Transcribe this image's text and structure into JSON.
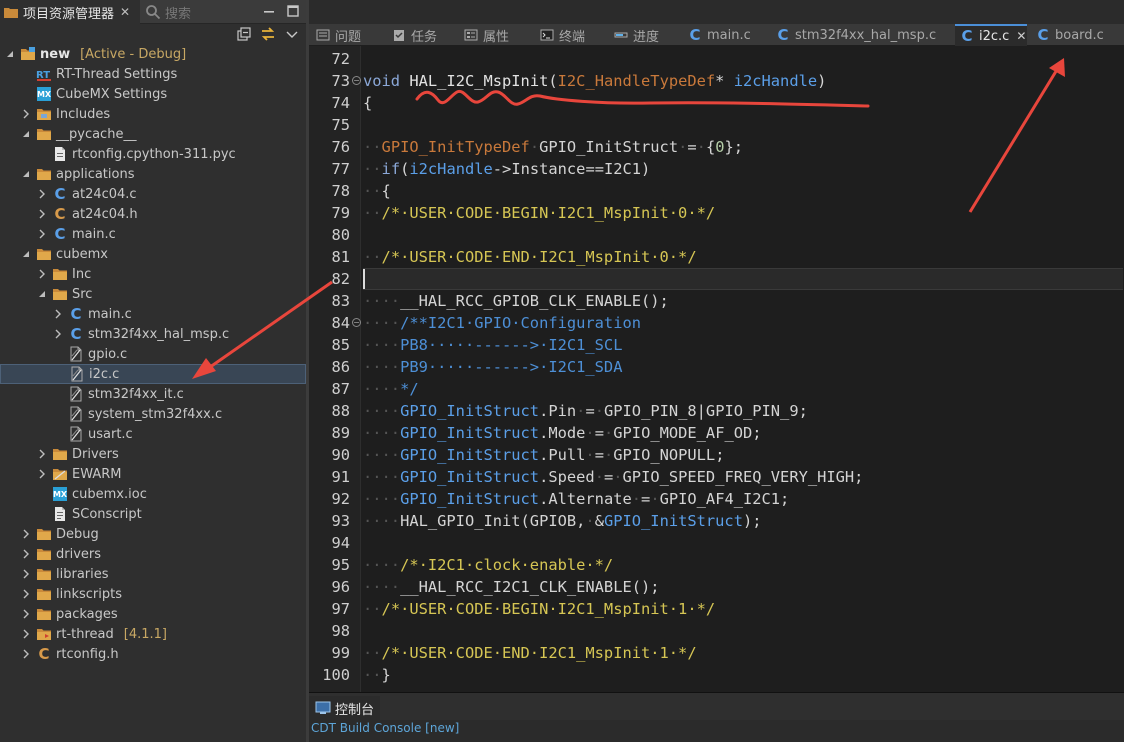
{
  "left_panel": {
    "explorer_tab": "项目资源管理器",
    "search_placeholder": "搜索"
  },
  "tree": [
    {
      "level": 0,
      "expanded": true,
      "icon": "project-folder-icon",
      "label": "new",
      "suffix": "[Active - Debug]",
      "bold": true
    },
    {
      "level": 1,
      "icon": "rt-thread-settings-icon",
      "label": "RT-Thread Settings"
    },
    {
      "level": 1,
      "icon": "cubemx-icon",
      "label": "CubeMX Settings"
    },
    {
      "level": 1,
      "expanded": false,
      "icon": "includes-folder-icon",
      "label": "Includes"
    },
    {
      "level": 1,
      "expanded": true,
      "icon": "folder-icon",
      "label": "__pycache__"
    },
    {
      "level": 2,
      "icon": "pyc-file-icon",
      "label": "rtconfig.cpython-311.pyc"
    },
    {
      "level": 1,
      "expanded": true,
      "icon": "folder-icon",
      "label": "applications"
    },
    {
      "level": 2,
      "expanded": false,
      "icon": "c-file-icon",
      "label": "at24c04.c"
    },
    {
      "level": 2,
      "expanded": false,
      "icon": "h-file-icon",
      "label": "at24c04.h"
    },
    {
      "level": 2,
      "expanded": false,
      "icon": "c-file-icon",
      "label": "main.c"
    },
    {
      "level": 1,
      "expanded": true,
      "icon": "folder-icon",
      "label": "cubemx"
    },
    {
      "level": 2,
      "expanded": false,
      "icon": "folder-icon",
      "label": "Inc"
    },
    {
      "level": 2,
      "expanded": true,
      "icon": "folder-icon",
      "label": "Src"
    },
    {
      "level": 3,
      "expanded": false,
      "icon": "c-file-icon",
      "label": "main.c"
    },
    {
      "level": 3,
      "expanded": false,
      "icon": "c-file-icon",
      "label": "stm32f4xx_hal_msp.c"
    },
    {
      "level": 3,
      "icon": "excluded-file-icon",
      "label": "gpio.c"
    },
    {
      "level": 3,
      "icon": "excluded-file-icon",
      "label": "i2c.c",
      "selected": true
    },
    {
      "level": 3,
      "icon": "excluded-file-icon",
      "label": "stm32f4xx_it.c"
    },
    {
      "level": 3,
      "icon": "excluded-file-icon",
      "label": "system_stm32f4xx.c"
    },
    {
      "level": 3,
      "icon": "excluded-file-icon",
      "label": "usart.c"
    },
    {
      "level": 2,
      "expanded": false,
      "icon": "folder-icon",
      "label": "Drivers"
    },
    {
      "level": 2,
      "expanded": false,
      "icon": "excluded-folder-icon",
      "label": "EWARM"
    },
    {
      "level": 2,
      "icon": "cubemx-icon",
      "label": "cubemx.ioc"
    },
    {
      "level": 2,
      "icon": "sconscript-file-icon",
      "label": "SConscript"
    },
    {
      "level": 1,
      "expanded": false,
      "icon": "folder-icon",
      "label": "Debug"
    },
    {
      "level": 1,
      "expanded": false,
      "icon": "folder-icon",
      "label": "drivers"
    },
    {
      "level": 1,
      "expanded": false,
      "icon": "folder-icon",
      "label": "libraries"
    },
    {
      "level": 1,
      "expanded": false,
      "icon": "folder-icon",
      "label": "linkscripts"
    },
    {
      "level": 1,
      "expanded": false,
      "icon": "folder-icon",
      "label": "packages"
    },
    {
      "level": 1,
      "expanded": false,
      "icon": "rt-thread-folder-icon",
      "label": "rt-thread",
      "suffix": "[4.1.1]"
    },
    {
      "level": 1,
      "expanded": false,
      "icon": "h-file-icon",
      "label": "rtconfig.h"
    }
  ],
  "editor_tabs": [
    {
      "label": "问题",
      "icon": "problems-icon"
    },
    {
      "label": "任务",
      "icon": "tasks-icon"
    },
    {
      "label": "属性",
      "icon": "properties-icon"
    },
    {
      "label": "终端",
      "icon": "terminal-icon"
    },
    {
      "label": "进度",
      "icon": "progress-icon"
    },
    {
      "label": "main.c",
      "icon": "c-file-icon"
    },
    {
      "label": "stm32f4xx_hal_msp.c",
      "icon": "c-file-icon"
    },
    {
      "label": "i2c.c",
      "icon": "c-file-icon",
      "active": true
    },
    {
      "label": "board.c",
      "icon": "c-file-icon"
    }
  ],
  "code_lines": [
    {
      "n": "72",
      "t": []
    },
    {
      "n": "73",
      "fold": true,
      "t": [
        [
          "kw",
          "void"
        ],
        [
          "op",
          " "
        ],
        [
          "fn",
          "HAL_I2C_MspInit"
        ],
        [
          "op",
          "("
        ],
        [
          "ty",
          "I2C_HandleTypeDef"
        ],
        [
          "op",
          "* "
        ],
        [
          "param",
          "i2cHandle"
        ],
        [
          "op",
          ")"
        ]
      ]
    },
    {
      "n": "74",
      "t": [
        [
          "op",
          "{"
        ]
      ]
    },
    {
      "n": "75",
      "t": []
    },
    {
      "n": "76",
      "t": [
        [
          "ws",
          "··"
        ],
        [
          "ty",
          "GPIO_InitTypeDef"
        ],
        [
          "ws",
          "·"
        ],
        [
          "op",
          "GPIO_InitStruct"
        ],
        [
          "ws",
          "·"
        ],
        [
          "op",
          "="
        ],
        [
          "ws",
          "·"
        ],
        [
          "op",
          "{"
        ],
        [
          "num",
          "0"
        ],
        [
          "op",
          "};"
        ]
      ]
    },
    {
      "n": "77",
      "t": [
        [
          "ws",
          "··"
        ],
        [
          "kw",
          "if"
        ],
        [
          "op",
          "("
        ],
        [
          "param",
          "i2cHandle"
        ],
        [
          "op",
          "->Instance==I2C1)"
        ]
      ]
    },
    {
      "n": "78",
      "t": [
        [
          "ws",
          "··"
        ],
        [
          "op",
          "{"
        ]
      ]
    },
    {
      "n": "79",
      "t": [
        [
          "ws",
          "··"
        ],
        [
          "cm",
          "/*·USER·CODE·BEGIN·I2C1_MspInit·0·*/"
        ]
      ]
    },
    {
      "n": "80",
      "t": []
    },
    {
      "n": "81",
      "t": [
        [
          "ws",
          "··"
        ],
        [
          "cm",
          "/*·USER·CODE·END·I2C1_MspInit·0·*/"
        ]
      ]
    },
    {
      "n": "82",
      "t": [],
      "current": true
    },
    {
      "n": "83",
      "t": [
        [
          "ws",
          "····"
        ],
        [
          "op",
          "__HAL_RCC_GPIOB_CLK_ENABLE();"
        ]
      ]
    },
    {
      "n": "84",
      "fold": true,
      "t": [
        [
          "ws",
          "····"
        ],
        [
          "cmd",
          "/**I2C1·GPIO·Configuration"
        ]
      ]
    },
    {
      "n": "85",
      "t": [
        [
          "ws",
          "····"
        ],
        [
          "cmd",
          "PB8·····------>·I2C1_SCL"
        ]
      ]
    },
    {
      "n": "86",
      "t": [
        [
          "ws",
          "····"
        ],
        [
          "cmd",
          "PB9·····------>·I2C1_SDA"
        ]
      ]
    },
    {
      "n": "87",
      "t": [
        [
          "ws",
          "····"
        ],
        [
          "cmd",
          "*/"
        ]
      ]
    },
    {
      "n": "88",
      "t": [
        [
          "ws",
          "····"
        ],
        [
          "var",
          "GPIO_InitStruct"
        ],
        [
          "op",
          ".Pin"
        ],
        [
          "ws",
          "·"
        ],
        [
          "op",
          "="
        ],
        [
          "ws",
          "·"
        ],
        [
          "op",
          "GPIO_PIN_8|GPIO_PIN_9;"
        ]
      ]
    },
    {
      "n": "89",
      "t": [
        [
          "ws",
          "····"
        ],
        [
          "var",
          "GPIO_InitStruct"
        ],
        [
          "op",
          ".Mode"
        ],
        [
          "ws",
          "·"
        ],
        [
          "op",
          "="
        ],
        [
          "ws",
          "·"
        ],
        [
          "op",
          "GPIO_MODE_AF_OD;"
        ]
      ]
    },
    {
      "n": "90",
      "t": [
        [
          "ws",
          "····"
        ],
        [
          "var",
          "GPIO_InitStruct"
        ],
        [
          "op",
          ".Pull"
        ],
        [
          "ws",
          "·"
        ],
        [
          "op",
          "="
        ],
        [
          "ws",
          "·"
        ],
        [
          "op",
          "GPIO_NOPULL;"
        ]
      ]
    },
    {
      "n": "91",
      "t": [
        [
          "ws",
          "····"
        ],
        [
          "var",
          "GPIO_InitStruct"
        ],
        [
          "op",
          ".Speed"
        ],
        [
          "ws",
          "·"
        ],
        [
          "op",
          "="
        ],
        [
          "ws",
          "·"
        ],
        [
          "op",
          "GPIO_SPEED_FREQ_VERY_HIGH;"
        ]
      ]
    },
    {
      "n": "92",
      "t": [
        [
          "ws",
          "····"
        ],
        [
          "var",
          "GPIO_InitStruct"
        ],
        [
          "op",
          ".Alternate"
        ],
        [
          "ws",
          "·"
        ],
        [
          "op",
          "="
        ],
        [
          "ws",
          "·"
        ],
        [
          "op",
          "GPIO_AF4_I2C1;"
        ]
      ]
    },
    {
      "n": "93",
      "t": [
        [
          "ws",
          "····"
        ],
        [
          "op",
          "HAL_GPIO_Init(GPIOB,"
        ],
        [
          "ws",
          "·"
        ],
        [
          "op",
          "&"
        ],
        [
          "var",
          "GPIO_InitStruct"
        ],
        [
          "op",
          ");"
        ]
      ]
    },
    {
      "n": "94",
      "t": []
    },
    {
      "n": "95",
      "t": [
        [
          "ws",
          "····"
        ],
        [
          "cm",
          "/*·I2C1·clock·enable·*/"
        ]
      ]
    },
    {
      "n": "96",
      "t": [
        [
          "ws",
          "····"
        ],
        [
          "op",
          "__HAL_RCC_I2C1_CLK_ENABLE();"
        ]
      ]
    },
    {
      "n": "97",
      "t": [
        [
          "ws",
          "··"
        ],
        [
          "cm",
          "/*·USER·CODE·BEGIN·I2C1_MspInit·1·*/"
        ]
      ]
    },
    {
      "n": "98",
      "t": []
    },
    {
      "n": "99",
      "t": [
        [
          "ws",
          "··"
        ],
        [
          "cm",
          "/*·USER·CODE·END·I2C1_MspInit·1·*/"
        ]
      ]
    },
    {
      "n": "100",
      "t": [
        [
          "ws",
          "··"
        ],
        [
          "op",
          "}"
        ]
      ]
    }
  ],
  "bottom_panel": {
    "console_tab": "控制台",
    "console_title": "CDT Build Console [new]"
  },
  "colors": {
    "annotation": "#e8463c",
    "selection": "#394655",
    "active_tab_accent": "#4b8fd8"
  }
}
